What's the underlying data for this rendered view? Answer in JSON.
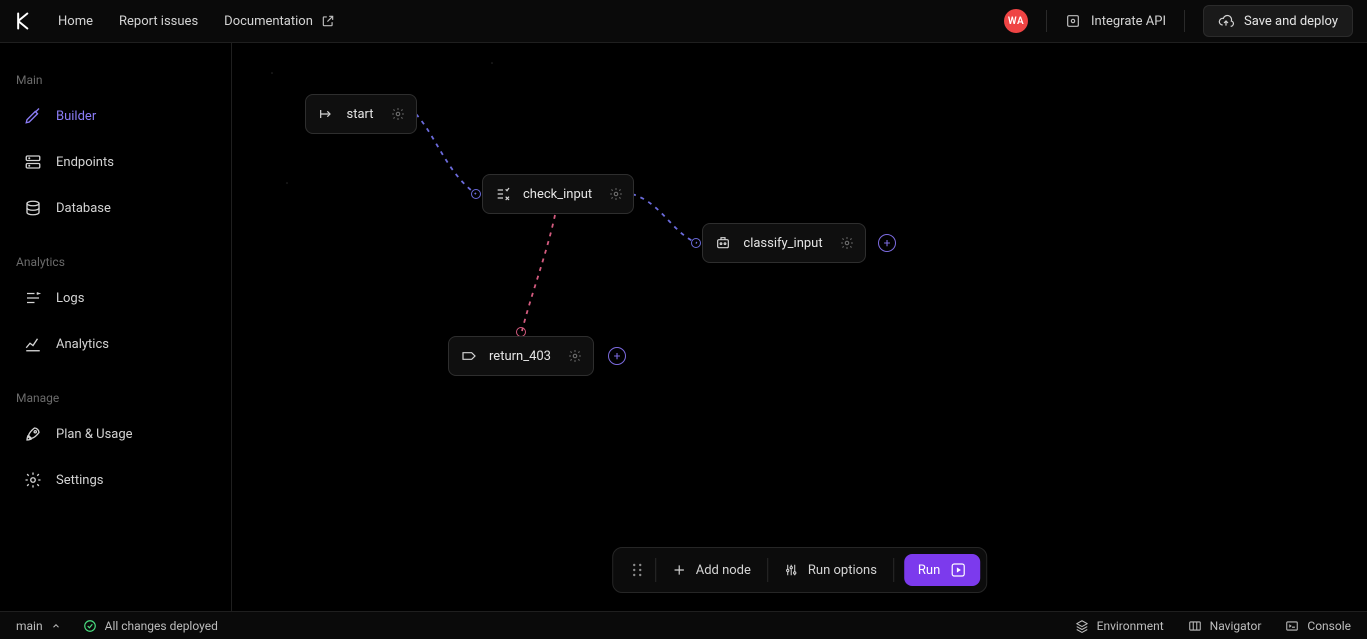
{
  "header": {
    "nav": {
      "home": "Home",
      "report_issues": "Report issues",
      "documentation": "Documentation"
    },
    "avatar_initials": "WA",
    "integrate_api": "Integrate API",
    "save_deploy": "Save and deploy"
  },
  "sidebar": {
    "groups": {
      "main": {
        "title": "Main",
        "builder": "Builder",
        "endpoints": "Endpoints",
        "database": "Database"
      },
      "analytics": {
        "title": "Analytics",
        "logs": "Logs",
        "analytics": "Analytics"
      },
      "manage": {
        "title": "Manage",
        "plan_usage": "Plan & Usage",
        "settings": "Settings"
      }
    }
  },
  "canvas": {
    "nodes": {
      "start": "start",
      "check_input": "check_input",
      "classify_input": "classify_input",
      "return_403": "return_403"
    }
  },
  "floatbar": {
    "add_node": "Add node",
    "run_options": "Run options",
    "run": "Run"
  },
  "statusbar": {
    "branch": "main",
    "deploy_status": "All changes deployed",
    "environment": "Environment",
    "navigator": "Navigator",
    "console": "Console"
  },
  "colors": {
    "edge_purple": "#6b6bdb",
    "edge_pink": "#d45b7f",
    "accent": "#7c3aed"
  }
}
